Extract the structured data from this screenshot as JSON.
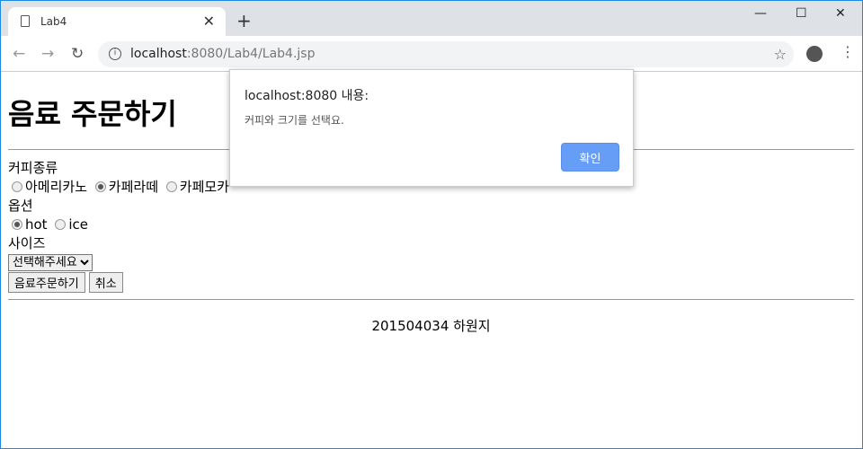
{
  "browser": {
    "tab_title": "Lab4",
    "url_host": "localhost",
    "url_rest": ":8080/Lab4/Lab4.jsp"
  },
  "page": {
    "title": "음료 주문하기",
    "coffee_label": "커피종류",
    "coffee_options": [
      {
        "label": "아메리카노",
        "checked": false
      },
      {
        "label": "카페라떼",
        "checked": true
      },
      {
        "label": "카페모카",
        "checked": false
      }
    ],
    "option_label": "옵션",
    "temp_options": [
      {
        "label": "hot",
        "checked": true
      },
      {
        "label": "ice",
        "checked": false
      }
    ],
    "size_label": "사이즈",
    "size_selected": "선택해주세요",
    "order_button": "음료주문하기",
    "cancel_button": "취소",
    "footer": "201504034 하원지"
  },
  "dialog": {
    "title": "localhost:8080 내용:",
    "message": "커피와 크기를 선택요.",
    "ok": "확인"
  }
}
